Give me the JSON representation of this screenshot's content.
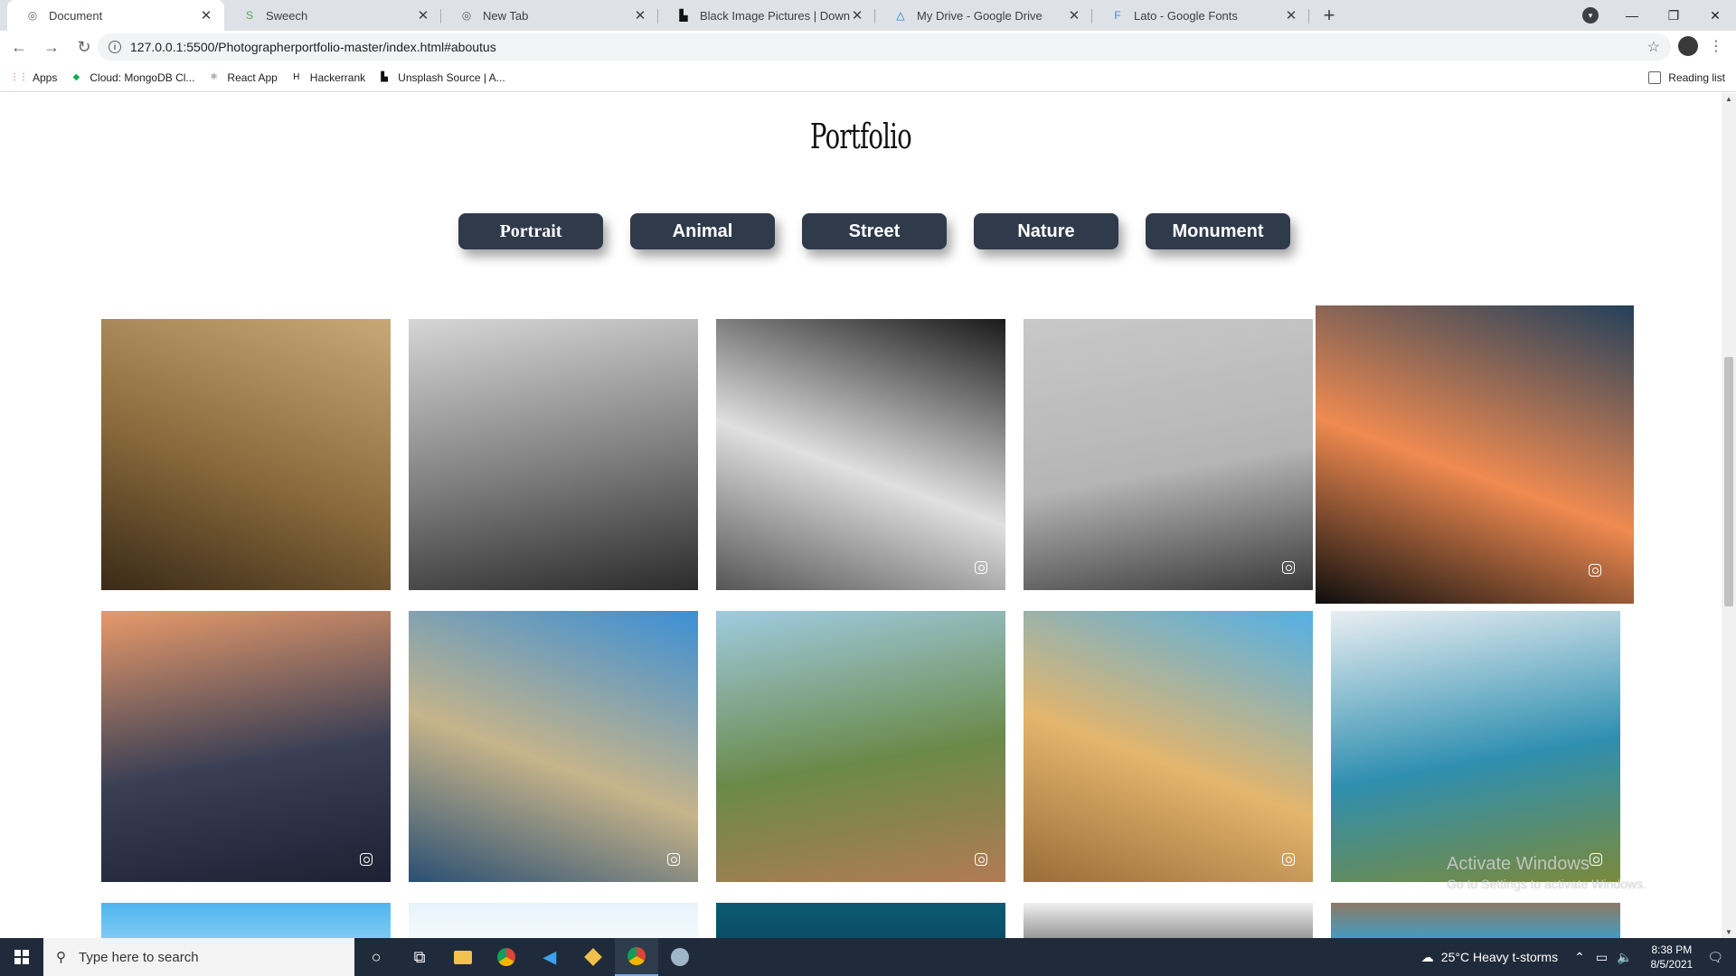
{
  "browser": {
    "tabs": [
      {
        "title": "Document",
        "icon": "globe-icon",
        "active": true
      },
      {
        "title": "Sweech",
        "icon": "sweech-icon",
        "active": false
      },
      {
        "title": "New Tab",
        "icon": "globe-icon",
        "active": false
      },
      {
        "title": "Black Image Pictures | Download",
        "icon": "unsplash-icon",
        "active": false
      },
      {
        "title": "My Drive - Google Drive",
        "icon": "drive-icon",
        "active": false
      },
      {
        "title": "Lato - Google Fonts",
        "icon": "google-fonts-icon",
        "active": false
      }
    ],
    "url": "127.0.0.1:5500/Photographerportfolio-master/index.html#aboutus",
    "bookmarks": [
      {
        "label": "Apps",
        "icon": "apps-grid-icon"
      },
      {
        "label": "Cloud: MongoDB Cl...",
        "icon": "mongodb-leaf-icon"
      },
      {
        "label": "React App",
        "icon": "react-icon"
      },
      {
        "label": "Hackerrank",
        "icon": "hackerrank-icon"
      },
      {
        "label": "Unsplash Source | A...",
        "icon": "unsplash-icon"
      }
    ],
    "reading_list": "Reading list"
  },
  "page": {
    "title": "Portfolio",
    "filters": [
      "Portrait",
      "Animal",
      "Street",
      "Nature",
      "Monument"
    ],
    "gallery": [
      {
        "subject": "puppy-closeup",
        "colors": [
          "#c9a877",
          "#8a6a3c",
          "#3a2a17"
        ],
        "instagram": false
      },
      {
        "subject": "egret-bw",
        "colors": [
          "#d6d6d6",
          "#7d7d7d",
          "#2c2c2c"
        ],
        "instagram": false
      },
      {
        "subject": "puppy-bw",
        "colors": [
          "#1a1a1a",
          "#e0e0e0",
          "#555555"
        ],
        "instagram": true
      },
      {
        "subject": "bare-tree-bw",
        "colors": [
          "#c8c8c8",
          "#b5b5b5",
          "#3a3a3a"
        ],
        "instagram": true
      },
      {
        "subject": "sunset-lake",
        "colors": [
          "#24405a",
          "#f08a50",
          "#0e0e0e"
        ],
        "instagram": true
      },
      {
        "subject": "sunset-river",
        "colors": [
          "#e89a6a",
          "#3a3f55",
          "#1c2233"
        ],
        "instagram": true
      },
      {
        "subject": "blue-river",
        "colors": [
          "#3b8fd6",
          "#c7b48a",
          "#2a4f73"
        ],
        "instagram": true
      },
      {
        "subject": "hand-bracelet",
        "colors": [
          "#9fcbe0",
          "#6a8a4a",
          "#b27a55"
        ],
        "instagram": true
      },
      {
        "subject": "taj-mahal",
        "colors": [
          "#53b0e6",
          "#e4b56c",
          "#9a6d3a"
        ],
        "instagram": true
      },
      {
        "subject": "mountain-tree",
        "colors": [
          "#e9eef2",
          "#2f8fb0",
          "#7a8a3a"
        ],
        "instagram": true
      },
      {
        "subject": "sky-partial",
        "colors": [
          "#4fb6ee",
          "#86cdf5"
        ],
        "instagram": false
      },
      {
        "subject": "white-partial",
        "colors": [
          "#e7f3fb",
          "#f5fbff"
        ],
        "instagram": false
      },
      {
        "subject": "teal-partial",
        "colors": [
          "#0d5b75",
          "#0a4b62"
        ],
        "instagram": false
      },
      {
        "subject": "grey-partial",
        "colors": [
          "#f0f0f0",
          "#8a8a8a"
        ],
        "instagram": false
      },
      {
        "subject": "rock-sky-partial",
        "colors": [
          "#8c7a64",
          "#3b9fd0"
        ],
        "instagram": false
      }
    ]
  },
  "watermark": {
    "line1": "Activate Windows",
    "line2": "Go to Settings to activate Windows."
  },
  "taskbar": {
    "search_placeholder": "Type here to search",
    "weather": "25°C  Heavy t-storms",
    "time": "8:38 PM",
    "date": "8/5/2021"
  }
}
